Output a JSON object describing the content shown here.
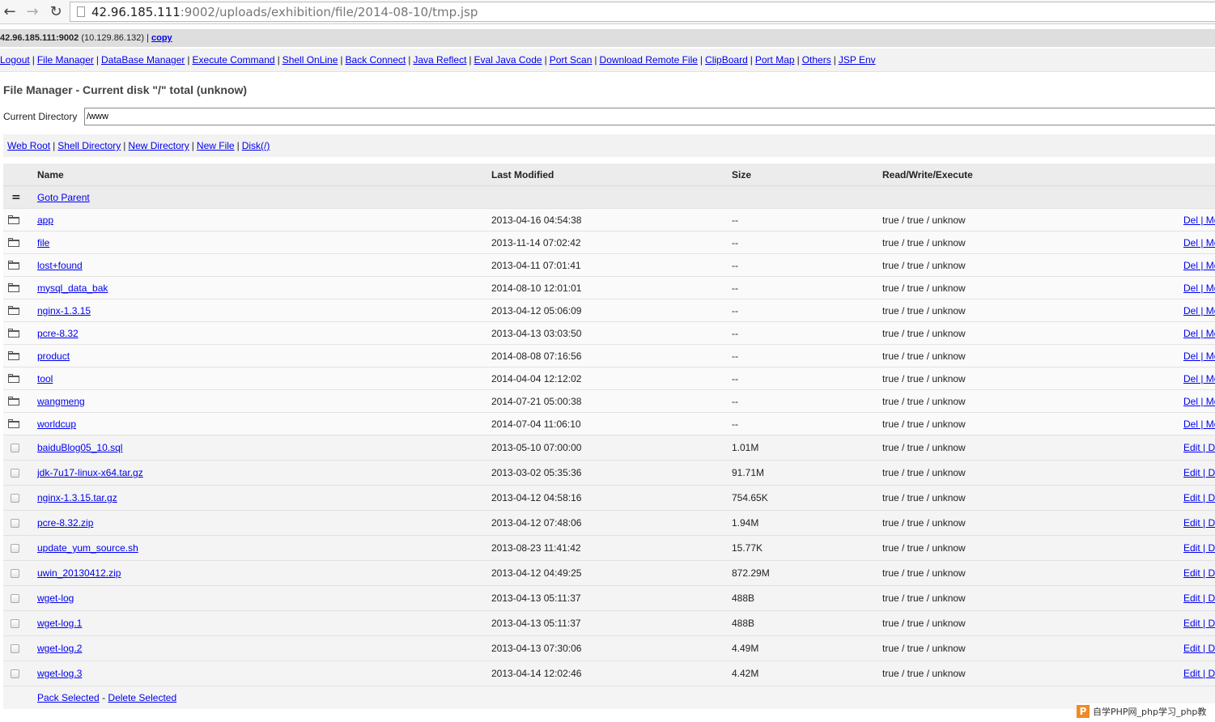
{
  "browser": {
    "url_host": "42.96.185.111",
    "url_rest": ":9002/uploads/exhibition/file/2014-08-10/tmp.jsp"
  },
  "info": {
    "host": "42.96.185.111:9002",
    "ip": "(10.129.86.132)",
    "divider": "|",
    "copy_label": "copy"
  },
  "menu": [
    "Logout",
    "File Manager",
    "DataBase Manager",
    "Execute Command",
    "Shell OnLine",
    "Back Connect",
    "Java Reflect",
    "Eval Java Code",
    "Port Scan",
    "Download Remote File",
    "ClipBoard",
    "Port Map",
    "Others",
    "JSP Env"
  ],
  "page": {
    "title": "File Manager - Current disk \"/\" total (unknow)",
    "current_dir_label": "Current Directory",
    "current_dir_value": "/www"
  },
  "quick_links": [
    "Web Root",
    "Shell Directory",
    "New Directory",
    "New File",
    "Disk(/)"
  ],
  "table": {
    "headers": {
      "name": "Name",
      "modified": "Last Modified",
      "size": "Size",
      "rwx": "Read/Write/Execute"
    },
    "parent_icon": "=",
    "parent_label": "Goto Parent",
    "dirs": [
      {
        "name": "app",
        "modified": "2013-04-16 04:54:38",
        "size": "--",
        "rwx": "true / true / unknow",
        "action": "Del | Mo"
      },
      {
        "name": "file",
        "modified": "2013-11-14 07:02:42",
        "size": "--",
        "rwx": "true / true / unknow",
        "action": "Del | Mo"
      },
      {
        "name": "lost+found",
        "modified": "2013-04-11 07:01:41",
        "size": "--",
        "rwx": "true / true / unknow",
        "action": "Del | Mo"
      },
      {
        "name": "mysql_data_bak",
        "modified": "2014-08-10 12:01:01",
        "size": "--",
        "rwx": "true / true / unknow",
        "action": "Del | Mo"
      },
      {
        "name": "nginx-1.3.15",
        "modified": "2013-04-12 05:06:09",
        "size": "--",
        "rwx": "true / true / unknow",
        "action": "Del | Mo"
      },
      {
        "name": "pcre-8.32",
        "modified": "2013-04-13 03:03:50",
        "size": "--",
        "rwx": "true / true / unknow",
        "action": "Del | Mo"
      },
      {
        "name": "product",
        "modified": "2014-08-08 07:16:56",
        "size": "--",
        "rwx": "true / true / unknow",
        "action": "Del | Mo"
      },
      {
        "name": "tool",
        "modified": "2014-04-04 12:12:02",
        "size": "--",
        "rwx": "true / true / unknow",
        "action": "Del | Mo"
      },
      {
        "name": "wangmeng",
        "modified": "2014-07-21 05:00:38",
        "size": "--",
        "rwx": "true / true / unknow",
        "action": "Del | Mo"
      },
      {
        "name": "worldcup",
        "modified": "2014-07-04 11:06:10",
        "size": "--",
        "rwx": "true / true / unknow",
        "action": "Del | Mo"
      }
    ],
    "files": [
      {
        "name": "baiduBlog05_10.sql",
        "modified": "2013-05-10 07:00:00",
        "size": "1.01M",
        "rwx": "true / true / unknow",
        "action": "Edit | D"
      },
      {
        "name": "jdk-7u17-linux-x64.tar.gz",
        "modified": "2013-03-02 05:35:36",
        "size": "91.71M",
        "rwx": "true / true / unknow",
        "action": "Edit | D"
      },
      {
        "name": "nginx-1.3.15.tar.gz",
        "modified": "2013-04-12 04:58:16",
        "size": "754.65K",
        "rwx": "true / true / unknow",
        "action": "Edit | D"
      },
      {
        "name": "pcre-8.32.zip",
        "modified": "2013-04-12 07:48:06",
        "size": "1.94M",
        "rwx": "true / true / unknow",
        "action": "Edit | D"
      },
      {
        "name": "update_yum_source.sh",
        "modified": "2013-08-23 11:41:42",
        "size": "15.77K",
        "rwx": "true / true / unknow",
        "action": "Edit | D"
      },
      {
        "name": "uwin_20130412.zip",
        "modified": "2013-04-12 04:49:25",
        "size": "872.29M",
        "rwx": "true / true / unknow",
        "action": "Edit | D"
      },
      {
        "name": "wget-log",
        "modified": "2013-04-13 05:11:37",
        "size": "488B",
        "rwx": "true / true / unknow",
        "action": "Edit | D"
      },
      {
        "name": "wget-log.1",
        "modified": "2013-04-13 05:11:37",
        "size": "488B",
        "rwx": "true / true / unknow",
        "action": "Edit | D"
      },
      {
        "name": "wget-log.2",
        "modified": "2013-04-13 07:30:06",
        "size": "4.49M",
        "rwx": "true / true / unknow",
        "action": "Edit | D"
      },
      {
        "name": "wget-log.3",
        "modified": "2013-04-14 12:02:46",
        "size": "4.42M",
        "rwx": "true / true / unknow",
        "action": "Edit | D"
      }
    ],
    "footer": {
      "pack": "Pack Selected",
      "dash": "-",
      "delete": "Delete Selected"
    }
  },
  "watermark": {
    "logo": "P",
    "text": "自学PHP网_php学习_php教"
  }
}
